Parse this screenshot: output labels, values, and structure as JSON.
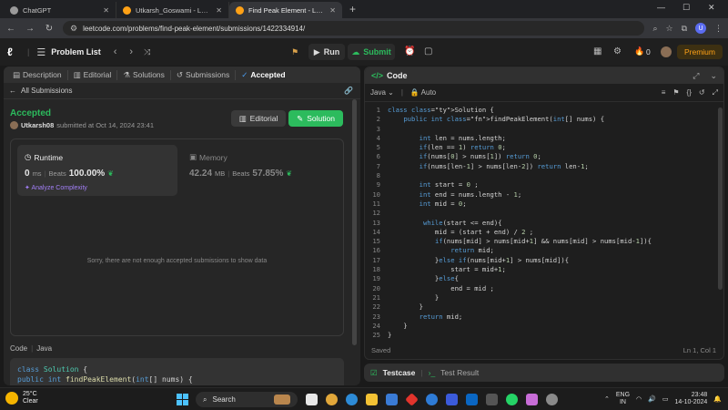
{
  "browser": {
    "tabs": [
      {
        "title": "ChatGPT",
        "favicon_color": "#9a9a9a"
      },
      {
        "title": "Utkarsh_Goswami - LeetCode Pr",
        "favicon_color": "#ffa116"
      },
      {
        "title": "Find Peak Element - LeetCode",
        "favicon_color": "#ffa116",
        "active": true
      }
    ],
    "url": "leetcode.com/problems/find-peak-element/submissions/1422334914/",
    "profile_initial": "U"
  },
  "lc_nav": {
    "problem_list": "Problem List",
    "run": "Run",
    "submit": "Submit",
    "streak": "0",
    "premium": "Premium"
  },
  "left": {
    "tabs": [
      "Description",
      "Editorial",
      "Solutions",
      "Submissions",
      "Accepted"
    ],
    "back_label": "All Submissions",
    "status": "Accepted",
    "user": "Utkarsh08",
    "submitted_text": "submitted at Oct 14, 2024 23:41",
    "editorial_btn": "Editorial",
    "solution_btn": "Solution",
    "runtime": {
      "label": "Runtime",
      "value": "0",
      "unit": "ms",
      "beats_label": "Beats",
      "pct": "100.00%",
      "analyze": "Analyze Complexity"
    },
    "memory": {
      "label": "Memory",
      "value": "42.24",
      "unit": "MB",
      "beats_label": "Beats",
      "pct": "57.85%"
    },
    "empty_msg": "Sorry, there are not enough accepted submissions to show data",
    "code_label": "Code",
    "code_lang": "Java",
    "preview_lines": [
      "class Solution {",
      "    public int findPeakElement(int[] nums) {"
    ]
  },
  "right": {
    "title": "Code",
    "language": "Java",
    "mode": "Auto",
    "saved": "Saved",
    "cursor": "Ln 1, Col 1",
    "testcase": "Testcase",
    "test_result": "Test Result"
  },
  "code": [
    "class Solution {",
    "    public int findPeakElement(int[] nums) {",
    "",
    "        int len = nums.length;",
    "        if(len == 1) return 0;",
    "        if(nums[0] > nums[1]) return 0;",
    "        if(nums[len-1] > nums[len-2]) return len-1;",
    "",
    "        int start = 0 ;",
    "        int end = nums.length - 1;",
    "        int mid = 0;",
    "",
    "         while(start <= end){",
    "            mid = (start + end) / 2 ;",
    "            if(nums[mid] > nums[mid+1] && nums[mid] > nums[mid-1]){",
    "                return mid;",
    "            }else if(nums[mid+1] > nums[mid]){",
    "                start = mid+1;",
    "            }else{",
    "                end = mid ;",
    "            }",
    "        }",
    "        return mid;",
    "    }",
    "}"
  ],
  "taskbar": {
    "temp": "25°C",
    "weather": "Clear",
    "search": "Search",
    "lang_top": "ENG",
    "lang_bottom": "IN",
    "time": "23:48",
    "date": "14-10-2024"
  },
  "colors": {
    "accent_green": "#2cbb5d",
    "premium_orange": "#ffa116",
    "analyze_purple": "#a27ff7"
  }
}
